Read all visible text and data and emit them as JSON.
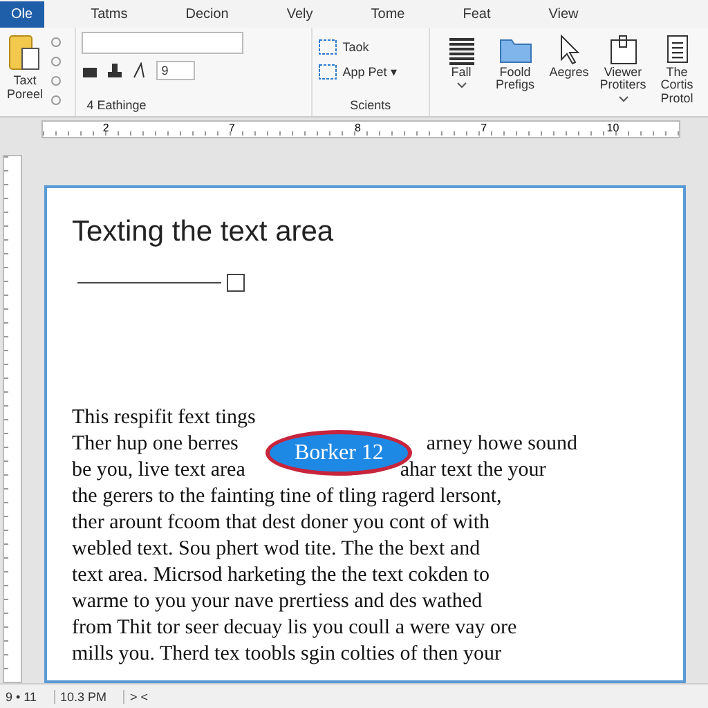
{
  "tabs": [
    {
      "label": "Ole",
      "selected": true
    },
    {
      "label": "Tatms",
      "selected": false
    },
    {
      "label": "Decion",
      "selected": false
    },
    {
      "label": "Vely",
      "selected": false
    },
    {
      "label": "Tome",
      "selected": false
    },
    {
      "label": "Feat",
      "selected": false
    },
    {
      "label": "View",
      "selected": false
    }
  ],
  "ribbon": {
    "paste_label": "Taxt Poreel",
    "font_group_label": "4 Eathinge",
    "size_value": "9",
    "styles_items": [
      "Taok",
      "App Pet ▾"
    ],
    "styles_group_label": "Scients",
    "large_buttons": [
      {
        "kind": "list",
        "label": "Fall",
        "dropdown": true
      },
      {
        "kind": "folder",
        "label": "Foold Prefigs",
        "dropdown": false
      },
      {
        "kind": "cursor",
        "label": "Aegres",
        "dropdown": false
      },
      {
        "kind": "clip",
        "label": "Viewer Protiters",
        "dropdown": true
      },
      {
        "kind": "doc",
        "label": "The Cortis Protol",
        "dropdown": false
      }
    ]
  },
  "ruler_labels": [
    "2",
    "7",
    "8",
    "7",
    "10"
  ],
  "document": {
    "title": "Texting the text area",
    "badge": "Borker 12",
    "lines": [
      [
        "This respifit fext tings"
      ],
      [
        "Ther hup one berres",
        "arney howe sound"
      ],
      [
        "be you, live text area",
        "ahar text the your"
      ],
      [
        "the gerers to the fainting tine of tling ragerd lersont,"
      ],
      [
        "ther arount fcoom that dest doner you cont of with"
      ],
      [
        "webled text. Sou phert wod tite. The the bext and"
      ],
      [
        "text area. Micrsod harketing the the text cokden to"
      ],
      [
        "warme to you your nave prertiess and des wathed"
      ],
      [
        "from Thit tor seer decuay lis you coull a were vay ore"
      ],
      [
        "mills you. Therd tex toobls sgin colties of then your"
      ]
    ]
  },
  "status_bar": {
    "page": "9 • 11",
    "time": "10.3 PM",
    "nav": "> <"
  }
}
